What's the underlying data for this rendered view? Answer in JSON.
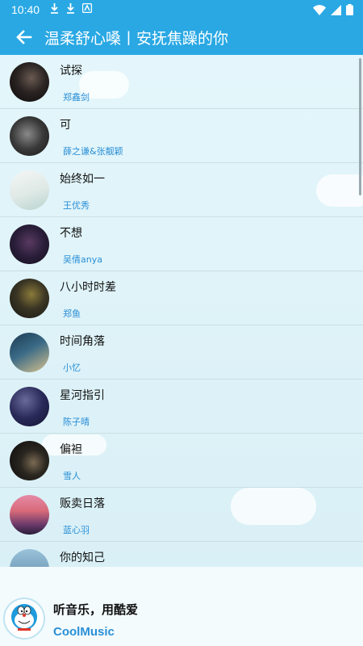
{
  "status_bar": {
    "time": "10:40",
    "icons": [
      "download-icon",
      "download-icon",
      "app-notification-icon"
    ],
    "right_icons": [
      "wifi-icon",
      "signal-icon",
      "battery-icon"
    ]
  },
  "app_bar": {
    "back_icon": "arrow-left-icon",
    "title": "温柔舒心嗓丨安抚焦躁的你"
  },
  "colors": {
    "app_bar": "#29a8e4",
    "artist_text": "#2a8fd6",
    "list_background": "#e1f3f8"
  },
  "songs": [
    {
      "name": "试探",
      "artist": "郑鑫剑"
    },
    {
      "name": "可",
      "artist": "薛之谦&张靓颖"
    },
    {
      "name": "始终如一",
      "artist": "王优秀"
    },
    {
      "name": "不想",
      "artist": "吴倩anya"
    },
    {
      "name": "八小时时差",
      "artist": "郑鱼"
    },
    {
      "name": "时间角落",
      "artist": "小忆"
    },
    {
      "name": "星河指引",
      "artist": "陈子晴"
    },
    {
      "name": "偏袒",
      "artist": "雪人"
    },
    {
      "name": "贩卖日落",
      "artist": "蓝心羽"
    },
    {
      "name": "你的知己",
      "artist": ""
    }
  ],
  "banner": {
    "slogan": "听音乐，用酷爱",
    "brand": "CoolMusic",
    "logo_icon": "doraemon-logo-icon"
  }
}
